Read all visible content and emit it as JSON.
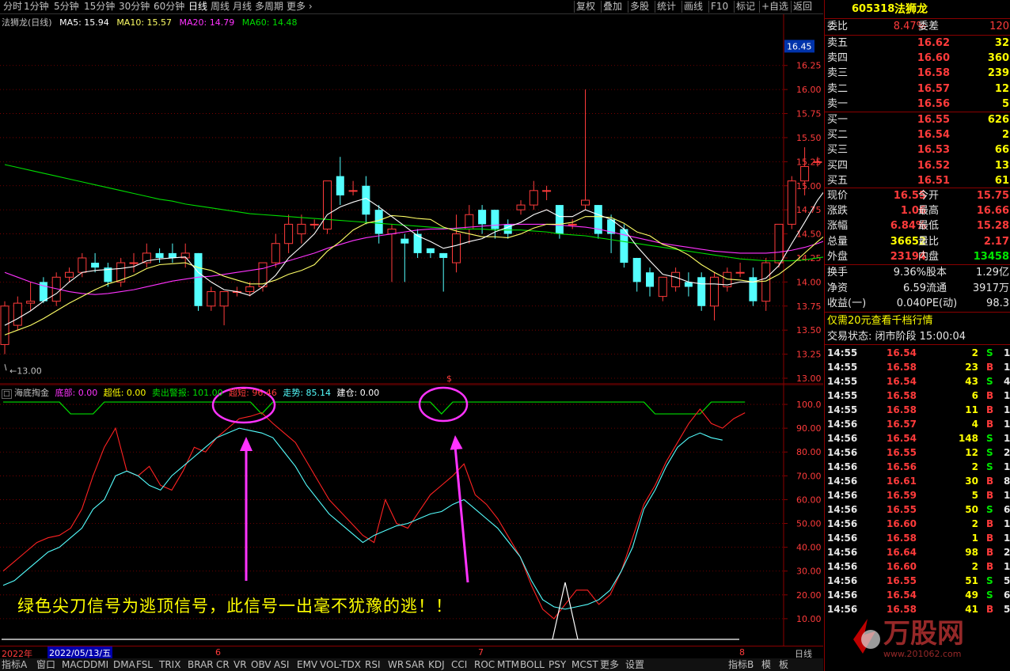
{
  "menu": {
    "items": [
      "分时",
      "1分钟",
      "5分钟",
      "15分钟",
      "30分钟",
      "60分钟",
      "日线",
      "周线",
      "月线",
      "多周期",
      "更多"
    ],
    "active": "日线",
    "right_items": [
      "复权",
      "叠加",
      "多股",
      "统计",
      "画线",
      "F10",
      "标记",
      "+自选",
      "返回"
    ]
  },
  "main_legend": {
    "title": "法狮龙(日线)",
    "ma5": "MA5: 15.94",
    "ma10": "MA10: 15.57",
    "ma20": "MA20: 14.79",
    "ma60": "MA60: 14.48"
  },
  "price_axis": {
    "labels": [
      "16.25",
      "16.00",
      "15.75",
      "15.50",
      "15.25",
      "15.00",
      "14.75",
      "14.50",
      "14.25",
      "14.00",
      "13.75",
      "13.50",
      "13.25",
      "13.00"
    ],
    "current": "16.45",
    "high_marker": "16.66",
    "low_marker": "13.00"
  },
  "indicator_legend": {
    "name": "海底掏金",
    "dibu": "底部: 0.00",
    "chaodi": "超低: 0.00",
    "maichu": "卖出警报: 101.00",
    "chaoduan": "超短: 96.46",
    "zoushi": "走势: 85.14",
    "jiancang": "建仓: 0.00",
    "dollar": "$"
  },
  "ind_axis": {
    "labels": [
      "100.0",
      "90.00",
      "80.00",
      "70.00",
      "60.00",
      "50.00",
      "40.00",
      "30.00",
      "20.00",
      "10.00"
    ]
  },
  "annotation": "绿色尖刀信号为逃顶信号，此信号一出毫不犹豫的逃！！",
  "x_axis": {
    "year": "2022年",
    "date": "2022/05/13/五",
    "months": [
      "6",
      "7",
      "8"
    ],
    "period": "日线"
  },
  "tabs": [
    "指标A",
    "窗口",
    "MACD",
    "DMI",
    "DMA",
    "FSL",
    "TRIX",
    "BRAR",
    "CR",
    "VR",
    "OBV",
    "ASI",
    "EMV",
    "VOL-TDX",
    "RSI",
    "WR",
    "SAR",
    "KDJ",
    "CCI",
    "ROC",
    "MTM",
    "BOLL",
    "PSY",
    "MCST",
    "更多",
    "设置"
  ],
  "tabs_right": [
    "指标B",
    "模",
    "板"
  ],
  "quote": {
    "code": "605318",
    "name": "法狮龙",
    "weibi_label": "委比",
    "weibi": "8.47%",
    "weicha_label": "委差",
    "weicha": "120",
    "asks": [
      {
        "label": "卖五",
        "price": "16.62",
        "vol": "32"
      },
      {
        "label": "卖四",
        "price": "16.60",
        "vol": "360"
      },
      {
        "label": "卖三",
        "price": "16.58",
        "vol": "239"
      },
      {
        "label": "卖二",
        "price": "16.57",
        "vol": "12"
      },
      {
        "label": "卖一",
        "price": "16.56",
        "vol": "5"
      }
    ],
    "bids": [
      {
        "label": "买一",
        "price": "16.55",
        "vol": "626"
      },
      {
        "label": "买二",
        "price": "16.54",
        "vol": "2"
      },
      {
        "label": "买三",
        "price": "16.53",
        "vol": "66"
      },
      {
        "label": "买四",
        "price": "16.52",
        "vol": "13"
      },
      {
        "label": "买五",
        "price": "16.51",
        "vol": "61"
      }
    ],
    "stats": [
      {
        "l1": "现价",
        "v1": "16.55",
        "c1": "red",
        "l2": "今开",
        "v2": "15.75",
        "c2": "red"
      },
      {
        "l1": "涨跌",
        "v1": "1.06",
        "c1": "red",
        "l2": "最高",
        "v2": "16.66",
        "c2": "red"
      },
      {
        "l1": "涨幅",
        "v1": "6.84%",
        "c1": "red",
        "l2": "最低",
        "v2": "15.28",
        "c2": "red"
      },
      {
        "l1": "总量",
        "v1": "36652",
        "c1": "yellow",
        "l2": "量比",
        "v2": "2.17",
        "c2": "red"
      },
      {
        "l1": "外盘",
        "v1": "23194",
        "c1": "red",
        "l2": "内盘",
        "v2": "13458",
        "c2": "green"
      }
    ],
    "stats2": [
      {
        "l1": "换手",
        "v1": "9.36%",
        "l2": "股本",
        "v2": "1.29亿"
      },
      {
        "l1": "净资",
        "v1": "6.59",
        "l2": "流通",
        "v2": "3917万"
      },
      {
        "l1": "收益(一)",
        "v1": "0.040",
        "l2": "PE(动)",
        "v2": "98.3"
      }
    ],
    "promo": "仅需20元查看千档行情",
    "status": "交易状态: 闭市阶段 15:00:04"
  },
  "ticks": [
    {
      "t": "14:55",
      "p": "16.54",
      "v": "2",
      "s": "S",
      "n": "1"
    },
    {
      "t": "14:55",
      "p": "16.58",
      "v": "23",
      "s": "B",
      "n": "1"
    },
    {
      "t": "14:55",
      "p": "16.54",
      "v": "43",
      "s": "S",
      "n": "4"
    },
    {
      "t": "14:55",
      "p": "16.58",
      "v": "6",
      "s": "B",
      "n": "1"
    },
    {
      "t": "14:55",
      "p": "16.58",
      "v": "11",
      "s": "B",
      "n": "1"
    },
    {
      "t": "14:56",
      "p": "16.57",
      "v": "4",
      "s": "B",
      "n": "1"
    },
    {
      "t": "14:56",
      "p": "16.54",
      "v": "148",
      "s": "S",
      "n": "12"
    },
    {
      "t": "14:56",
      "p": "16.55",
      "v": "12",
      "s": "S",
      "n": "2"
    },
    {
      "t": "14:56",
      "p": "16.56",
      "v": "2",
      "s": "S",
      "n": "1"
    },
    {
      "t": "14:56",
      "p": "16.61",
      "v": "30",
      "s": "B",
      "n": "8"
    },
    {
      "t": "14:56",
      "p": "16.59",
      "v": "5",
      "s": "B",
      "n": "1"
    },
    {
      "t": "14:56",
      "p": "16.55",
      "v": "50",
      "s": "S",
      "n": "6"
    },
    {
      "t": "14:56",
      "p": "16.60",
      "v": "2",
      "s": "B",
      "n": "1"
    },
    {
      "t": "14:56",
      "p": "16.58",
      "v": "1",
      "s": "B",
      "n": "1"
    },
    {
      "t": "14:56",
      "p": "16.64",
      "v": "98",
      "s": "B",
      "n": "21"
    },
    {
      "t": "14:56",
      "p": "16.60",
      "v": "2",
      "s": "B",
      "n": "1"
    },
    {
      "t": "14:56",
      "p": "16.55",
      "v": "51",
      "s": "S",
      "n": "5"
    },
    {
      "t": "14:56",
      "p": "16.54",
      "v": "49",
      "s": "S",
      "n": "6"
    },
    {
      "t": "14:56",
      "p": "16.58",
      "v": "41",
      "s": "B",
      "n": "5"
    }
  ],
  "watermark": {
    "brand": "万股网",
    "url": "www.201062.com"
  },
  "colors": {
    "up": "#ff3b3b",
    "down": "#54ffff",
    "ma5": "#ffffff",
    "ma10": "#ffff66",
    "ma20": "#ff33ff",
    "ma60": "#00dd00",
    "grid": "#8b0000",
    "annotation": "#ffff00",
    "arrow": "#ff33ff"
  },
  "chart_data": {
    "type": "candlestick",
    "ylim": [
      13.0,
      16.7
    ],
    "candles": [
      [
        13.35,
        13.75,
        13.25,
        13.8
      ],
      [
        13.55,
        13.78,
        13.5,
        13.85
      ],
      [
        13.78,
        13.8,
        13.7,
        14.0
      ],
      [
        14.0,
        13.8,
        13.78,
        14.05
      ],
      [
        13.8,
        14.05,
        13.75,
        14.1
      ],
      [
        14.05,
        14.1,
        14.0,
        14.15
      ],
      [
        14.1,
        14.25,
        14.05,
        14.3
      ],
      [
        14.2,
        14.15,
        14.1,
        14.3
      ],
      [
        14.15,
        14.0,
        13.95,
        14.2
      ],
      [
        14.0,
        14.2,
        13.95,
        14.25
      ],
      [
        14.2,
        14.2,
        14.1,
        14.3
      ],
      [
        14.2,
        14.3,
        14.15,
        14.4
      ],
      [
        14.3,
        14.25,
        14.2,
        14.35
      ],
      [
        14.3,
        14.25,
        14.2,
        14.4
      ],
      [
        14.25,
        14.3,
        14.15,
        14.4
      ],
      [
        14.3,
        13.75,
        13.7,
        14.3
      ],
      [
        13.75,
        13.9,
        13.7,
        13.95
      ],
      [
        13.75,
        13.9,
        13.55,
        13.9
      ],
      [
        13.9,
        13.9,
        13.85,
        13.95
      ],
      [
        13.9,
        13.95,
        13.85,
        14.0
      ],
      [
        13.95,
        14.2,
        13.9,
        14.2
      ],
      [
        14.2,
        14.4,
        14.15,
        14.5
      ],
      [
        14.4,
        14.6,
        14.3,
        14.7
      ],
      [
        14.5,
        14.6,
        14.4,
        14.7
      ],
      [
        14.6,
        14.6,
        14.55,
        14.65
      ],
      [
        14.55,
        15.05,
        14.5,
        15.05
      ],
      [
        15.1,
        14.9,
        14.8,
        15.3
      ],
      [
        14.95,
        14.95,
        14.9,
        15.05
      ],
      [
        15.0,
        14.7,
        14.6,
        15.1
      ],
      [
        14.75,
        14.5,
        14.4,
        14.8
      ],
      [
        14.5,
        14.55,
        14.0,
        14.6
      ],
      [
        14.45,
        14.4,
        14.0,
        14.5
      ],
      [
        14.5,
        14.3,
        14.25,
        14.55
      ],
      [
        14.35,
        14.3,
        14.25,
        14.35
      ],
      [
        14.3,
        14.25,
        13.9,
        14.3
      ],
      [
        14.2,
        14.5,
        14.1,
        14.7
      ],
      [
        14.55,
        14.7,
        14.4,
        14.8
      ],
      [
        14.75,
        14.6,
        14.5,
        14.8
      ],
      [
        14.75,
        14.55,
        14.45,
        14.75
      ],
      [
        14.6,
        14.5,
        14.45,
        14.65
      ],
      [
        14.75,
        14.8,
        14.7,
        14.85
      ],
      [
        14.8,
        14.95,
        14.75,
        15.05
      ],
      [
        14.95,
        14.95,
        14.85,
        15.0
      ],
      [
        14.8,
        14.5,
        14.45,
        14.8
      ],
      [
        14.6,
        14.6,
        14.55,
        14.65
      ],
      [
        14.8,
        14.85,
        14.75,
        16.0
      ],
      [
        14.8,
        14.5,
        14.45,
        14.8
      ],
      [
        14.65,
        14.5,
        14.3,
        14.7
      ],
      [
        14.55,
        14.2,
        14.15,
        14.6
      ],
      [
        14.25,
        14.0,
        13.9,
        14.25
      ],
      [
        14.1,
        13.95,
        13.85,
        14.15
      ],
      [
        13.85,
        14.05,
        13.8,
        14.05
      ],
      [
        13.95,
        14.1,
        13.9,
        14.15
      ],
      [
        14.0,
        13.95,
        13.85,
        14.1
      ],
      [
        14.05,
        13.75,
        13.7,
        14.1
      ],
      [
        13.75,
        14.05,
        13.6,
        14.1
      ],
      [
        13.95,
        14.1,
        13.9,
        14.15
      ],
      [
        14.1,
        14.1,
        14.05,
        14.2
      ],
      [
        14.05,
        13.8,
        13.75,
        14.15
      ],
      [
        13.8,
        14.2,
        13.7,
        14.25
      ],
      [
        14.2,
        14.6,
        14.15,
        14.6
      ],
      [
        14.6,
        15.05,
        14.55,
        15.1
      ],
      [
        15.05,
        15.2,
        14.9,
        15.4
      ],
      [
        15.25,
        15.25,
        15.2,
        15.3
      ],
      [
        15.3,
        15.45,
        15.25,
        15.55
      ],
      [
        15.4,
        15.6,
        15.35,
        15.85
      ],
      [
        15.6,
        15.85,
        15.5,
        16.0
      ],
      [
        15.85,
        16.0,
        15.6,
        16.15
      ],
      [
        16.0,
        15.9,
        15.85,
        16.2
      ],
      [
        16.0,
        15.85,
        15.8,
        16.1
      ],
      [
        15.75,
        15.5,
        15.45,
        16.2
      ],
      [
        15.75,
        16.45,
        15.28,
        16.66
      ]
    ],
    "ma5": [
      13.55,
      13.62,
      13.7,
      13.8,
      13.88,
      14.0,
      14.1,
      14.12,
      14.13,
      14.14,
      14.16,
      14.22,
      14.24,
      14.25,
      14.26,
      14.1,
      14.0,
      13.92,
      13.9,
      13.86,
      13.95,
      14.07,
      14.25,
      14.37,
      14.5,
      14.7,
      14.78,
      14.83,
      14.87,
      14.78,
      14.68,
      14.58,
      14.48,
      14.42,
      14.35,
      14.38,
      14.42,
      14.45,
      14.52,
      14.57,
      14.62,
      14.7,
      14.75,
      14.68,
      14.68,
      14.75,
      14.7,
      14.65,
      14.55,
      14.37,
      14.22,
      14.08,
      14.05,
      14.0,
      13.98,
      13.98,
      13.97,
      14.0,
      14.0,
      14.04,
      14.17,
      14.4,
      14.62,
      14.85,
      15.03,
      15.3,
      15.46,
      15.62,
      15.74,
      15.84,
      15.8,
      15.94
    ],
    "ma10": [
      13.45,
      13.5,
      13.55,
      13.62,
      13.7,
      13.78,
      13.85,
      13.92,
      13.98,
      14.02,
      14.07,
      14.14,
      14.18,
      14.19,
      14.2,
      14.15,
      14.12,
      14.06,
      14.02,
      13.98,
      13.98,
      14.02,
      14.08,
      14.12,
      14.18,
      14.32,
      14.42,
      14.54,
      14.61,
      14.64,
      14.69,
      14.68,
      14.66,
      14.65,
      14.57,
      14.53,
      14.5,
      14.47,
      14.47,
      14.46,
      14.5,
      14.56,
      14.6,
      14.6,
      14.62,
      14.68,
      14.68,
      14.67,
      14.61,
      14.52,
      14.48,
      14.39,
      14.35,
      14.28,
      14.18,
      14.1,
      14.03,
      14.02,
      14.0,
      14.01,
      14.08,
      14.18,
      14.3,
      14.42,
      14.53,
      14.74,
      14.91,
      15.06,
      15.21,
      15.33,
      15.43,
      15.57
    ],
    "ma20": [
      14.1,
      14.05,
      14.0,
      13.96,
      13.93,
      13.9,
      13.88,
      13.87,
      13.88,
      13.9,
      13.92,
      13.95,
      13.98,
      14.01,
      14.03,
      14.05,
      14.06,
      14.08,
      14.1,
      14.12,
      14.14,
      14.18,
      14.22,
      14.26,
      14.3,
      14.35,
      14.39,
      14.43,
      14.46,
      14.48,
      14.5,
      14.52,
      14.54,
      14.55,
      14.55,
      14.56,
      14.57,
      14.58,
      14.59,
      14.6,
      14.6,
      14.6,
      14.6,
      14.59,
      14.58,
      14.57,
      14.55,
      14.52,
      14.49,
      14.46,
      14.43,
      14.4,
      14.38,
      14.36,
      14.34,
      14.32,
      14.31,
      14.3,
      14.3,
      14.3,
      14.31,
      14.33,
      14.36,
      14.4,
      14.45,
      14.5,
      14.55,
      14.6,
      14.65,
      14.69,
      14.74,
      14.79
    ],
    "ma60": [
      15.22,
      15.19,
      15.16,
      15.13,
      15.1,
      15.07,
      15.04,
      15.01,
      14.98,
      14.95,
      14.92,
      14.89,
      14.86,
      14.84,
      14.81,
      14.79,
      14.77,
      14.75,
      14.73,
      14.71,
      14.7,
      14.69,
      14.68,
      14.67,
      14.66,
      14.65,
      14.64,
      14.63,
      14.62,
      14.61,
      14.6,
      14.59,
      14.58,
      14.57,
      14.56,
      14.55,
      14.55,
      14.55,
      14.54,
      14.54,
      14.54,
      14.53,
      14.52,
      14.5,
      14.49,
      14.48,
      14.46,
      14.44,
      14.42,
      14.4,
      14.38,
      14.36,
      14.34,
      14.32,
      14.3,
      14.28,
      14.26,
      14.24,
      14.23,
      14.22,
      14.22,
      14.22,
      14.23,
      14.25,
      14.27,
      14.3,
      14.33,
      14.36,
      14.39,
      14.42,
      14.45,
      14.48
    ],
    "indicator": {
      "ylim": [
        0,
        105
      ],
      "chaoduan": [
        30,
        34,
        38,
        42,
        44,
        45,
        48,
        56,
        70,
        82,
        90,
        72,
        70,
        74,
        66,
        64,
        72,
        82,
        80,
        86,
        90,
        94,
        95,
        96.5,
        92,
        88,
        84,
        76,
        68,
        60,
        55,
        50,
        45,
        42,
        60,
        50,
        48,
        55,
        62,
        66,
        70,
        75,
        62,
        58,
        52,
        44,
        36,
        24,
        14,
        10,
        16,
        22,
        22,
        16,
        20,
        30,
        44,
        58,
        66,
        76,
        84,
        92,
        98,
        92,
        90,
        94,
        96.5
      ],
      "zoushi": [
        24,
        26,
        30,
        34,
        38,
        40,
        44,
        48,
        56,
        60,
        70,
        72,
        70,
        66,
        64,
        70,
        74,
        78,
        82,
        86,
        88,
        90,
        89,
        88,
        86,
        80,
        74,
        66,
        60,
        54,
        50,
        46,
        42,
        45,
        47,
        49,
        50,
        52,
        54,
        55,
        58,
        60,
        56,
        52,
        48,
        42,
        36,
        26,
        18,
        15,
        14,
        15,
        16,
        18,
        22,
        30,
        40,
        56,
        64,
        74,
        82,
        86,
        88,
        86,
        85
      ],
      "baseline": [
        101,
        101,
        101,
        101,
        101,
        101,
        96,
        96,
        96,
        101,
        101,
        101,
        101,
        101,
        101,
        101,
        101,
        101,
        101,
        101,
        101,
        101,
        101,
        96,
        101,
        101,
        101,
        101,
        101,
        101,
        101,
        101,
        101,
        101,
        101,
        101,
        101,
        101,
        101,
        96,
        101,
        101,
        101,
        101,
        101,
        101,
        101,
        101,
        101,
        101,
        101,
        101,
        101,
        101,
        101,
        101,
        101,
        101,
        96,
        96,
        96,
        96,
        96,
        101,
        101,
        101,
        101
      ]
    }
  }
}
